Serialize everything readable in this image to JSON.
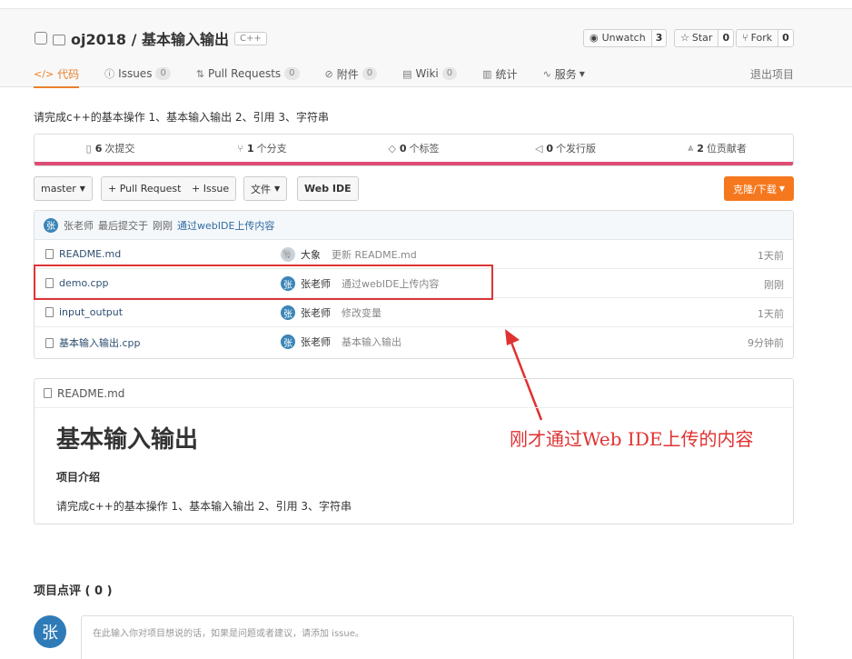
{
  "repo": {
    "owner": "oj2018",
    "name": "基本输入输出",
    "full_title": "oj2018 / 基本输入输出",
    "language": "C++"
  },
  "social": {
    "watch": {
      "label": "Unwatch",
      "count": "3"
    },
    "star": {
      "label": "Star",
      "count": "0"
    },
    "fork": {
      "label": "Fork",
      "count": "0"
    }
  },
  "tabs": [
    {
      "label": "代码",
      "icon": "code-icon",
      "badge": ""
    },
    {
      "label": "Issues",
      "icon": "issue-icon",
      "badge": "0"
    },
    {
      "label": "Pull Requests",
      "icon": "pull-request-icon",
      "badge": "0"
    },
    {
      "label": "附件",
      "icon": "attachment-icon",
      "badge": "0"
    },
    {
      "label": "Wiki",
      "icon": "wiki-icon",
      "badge": "0"
    },
    {
      "label": "统计",
      "icon": "stats-icon",
      "badge": ""
    },
    {
      "label": "服务",
      "icon": "service-icon",
      "badge": ""
    }
  ],
  "quit_label": "退出项目",
  "description": "请完成c++的基本操作 1、基本输入输出 2、引用 3、字符串",
  "stats": [
    {
      "count": "6",
      "label": "次提交"
    },
    {
      "count": "1",
      "label": "个分支"
    },
    {
      "count": "0",
      "label": "个标签"
    },
    {
      "count": "0",
      "label": "个发行版"
    },
    {
      "count": "2",
      "label": "位贡献者"
    }
  ],
  "toolbar": {
    "branch": "master",
    "pull_request": "+ Pull Request",
    "issue": "+ Issue",
    "file": "文件",
    "web_ide": "Web IDE",
    "clone": "克隆/下载"
  },
  "last_commit": {
    "avatar": "张",
    "author": "张老师",
    "text": "最后提交于",
    "time": "刚刚",
    "message": "通过webIDE上传内容"
  },
  "files": [
    {
      "name": "README.md",
      "avatar": "🐘",
      "author": "大象",
      "message": "更新 README.md",
      "time": "1天前"
    },
    {
      "name": "demo.cpp",
      "avatar": "张",
      "author": "张老师",
      "message": "通过webIDE上传内容",
      "time": "刚刚"
    },
    {
      "name": "input_output",
      "avatar": "张",
      "author": "张老师",
      "message": "修改变量",
      "time": "1天前"
    },
    {
      "name": "基本输入输出.cpp",
      "avatar": "张",
      "author": "张老师",
      "message": "基本输入输出",
      "time": "9分钟前"
    }
  ],
  "annotation": "刚才通过Web IDE上传的内容",
  "readme": {
    "filename": "README.md",
    "title": "基本输入输出",
    "section": "项目介绍",
    "body": "请完成c++的基本操作 1、基本输入输出 2、引用 3、字符串"
  },
  "review": {
    "title": "项目点评 ( 0 )",
    "avatar": "张",
    "placeholder": "在此输入你对项目想说的话，如果是问题或者建议，请添加 issue。"
  },
  "colors": {
    "accent": "#e8812b",
    "clone_button": "#f5781e",
    "stats_bar": "#de4d74",
    "annotation": "#e03131"
  }
}
